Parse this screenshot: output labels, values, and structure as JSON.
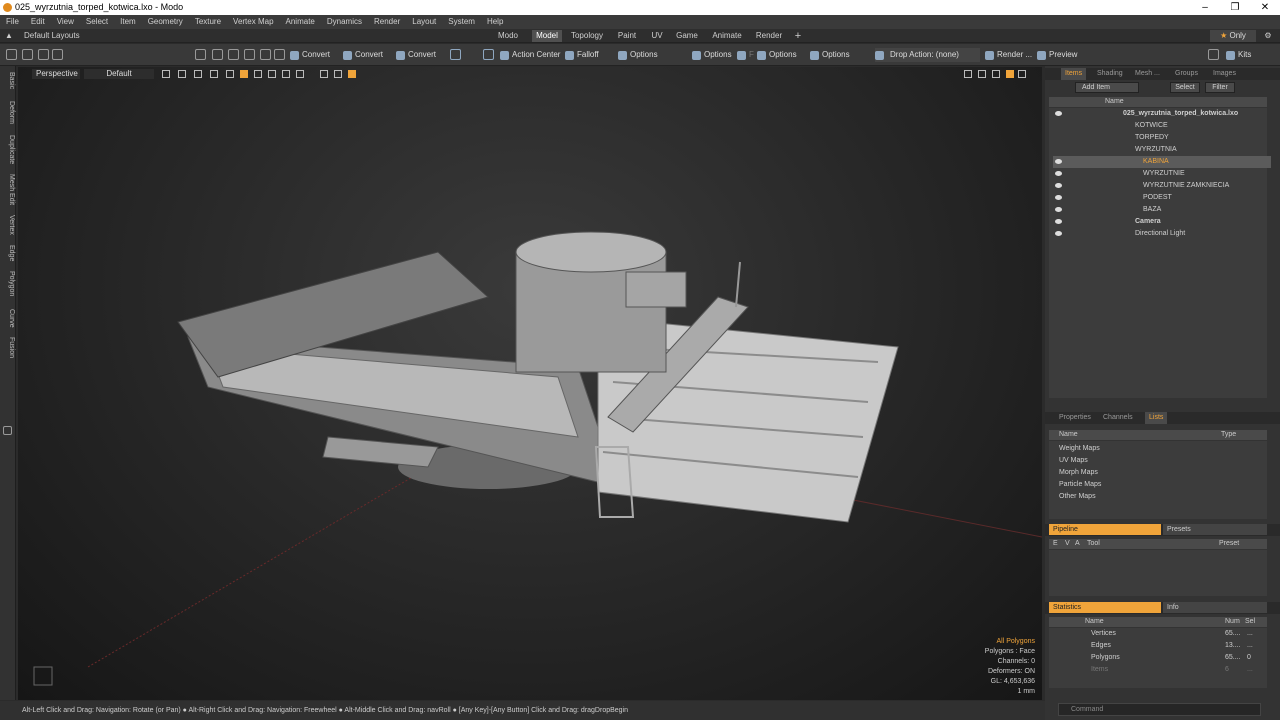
{
  "window": {
    "title": "025_wyrzutnia_torped_kotwica.lxo - Modo"
  },
  "menu": [
    "File",
    "Edit",
    "View",
    "Select",
    "Item",
    "Geometry",
    "Texture",
    "Vertex Map",
    "Animate",
    "Dynamics",
    "Render",
    "Layout",
    "System",
    "Help"
  ],
  "layout": {
    "name": "Default Layouts",
    "tabs": [
      "Modo",
      "Model",
      "Topology",
      "Paint",
      "UV",
      "Game",
      "Animate",
      "Render"
    ],
    "add": "+",
    "only": "Only"
  },
  "toolbar": {
    "convert1": "Convert",
    "convert2": "Convert",
    "convert3": "Convert",
    "action_center": "Action Center",
    "falloff": "Falloff",
    "options1": "Options",
    "options2": "Options",
    "options3": "Options",
    "options4": "Options",
    "f": "F",
    "drop_action": "Drop Action: (none)",
    "render": "Render ...",
    "preview": "Preview",
    "kits": "Kits"
  },
  "left_tabs": [
    "Basic",
    "Deform",
    "Duplicate",
    "Mesh Edit",
    "Vertex",
    "Edge",
    "Polygon",
    "Curve",
    "Fusion"
  ],
  "viewport": {
    "perspective": "Perspective",
    "shading": "Default"
  },
  "stats": {
    "all_polygons": "All Polygons",
    "polygons": "Polygons : Face",
    "channels": "Channels: 0",
    "deformers": "Deformers: ON",
    "gl": "GL: 4,653,636",
    "scale": "1 mm"
  },
  "statusbar": "Alt-Left Click and Drag: Navigation: Rotate (or Pan) ● Alt-Right Click and Drag: Navigation: Freewheel ● Alt-Middle Click and Drag: navRoll ● [Any Key]-[Any Button] Click and Drag: dragDropBegin",
  "items_panel": {
    "tabs": [
      "Items",
      "Shading",
      "Mesh ...",
      "Groups",
      "Images"
    ],
    "add_item": "Add Item",
    "select": "Select",
    "filter": "Filter",
    "col_name": "Name",
    "rows": [
      "025_wyrzutnia_torped_kotwica.lxo",
      "KOTWICE",
      "TORPEDY",
      "WYRZUTNIA",
      "KABINA",
      "WYRZUTNIE",
      "WYRZUTNIE ZAMKNIECIA",
      "PODEST",
      "BAZA",
      "Camera",
      "Directional Light"
    ]
  },
  "lists_panel": {
    "tabs": [
      "Properties",
      "Channels",
      "Lists"
    ],
    "col_name": "Name",
    "col_type": "Type",
    "rows": [
      "Weight Maps",
      "UV Maps",
      "Morph Maps",
      "Particle Maps",
      "Other Maps"
    ]
  },
  "pipeline_panel": {
    "tabs": [
      "Pipeline",
      "Presets"
    ],
    "col_tool": "Tool",
    "col_preset": "Preset",
    "col_e": "E",
    "col_v": "V",
    "col_a": "A"
  },
  "statistics_panel": {
    "tabs": [
      "Statistics",
      "Info"
    ],
    "col_name": "Name",
    "col_num": "Num",
    "col_sel": "Sel",
    "rows": [
      {
        "name": "Vertices",
        "num": "65....",
        "sel": "..."
      },
      {
        "name": "Edges",
        "num": "13....",
        "sel": "..."
      },
      {
        "name": "Polygons",
        "num": "65....",
        "sel": "0"
      },
      {
        "name": "Items",
        "num": "6",
        "sel": "..."
      }
    ]
  },
  "command": {
    "placeholder": "Command"
  },
  "colors": {
    "accent": "#f0a43a",
    "bg": "#2b2b2b",
    "selected_row": "#5b5b5b"
  }
}
